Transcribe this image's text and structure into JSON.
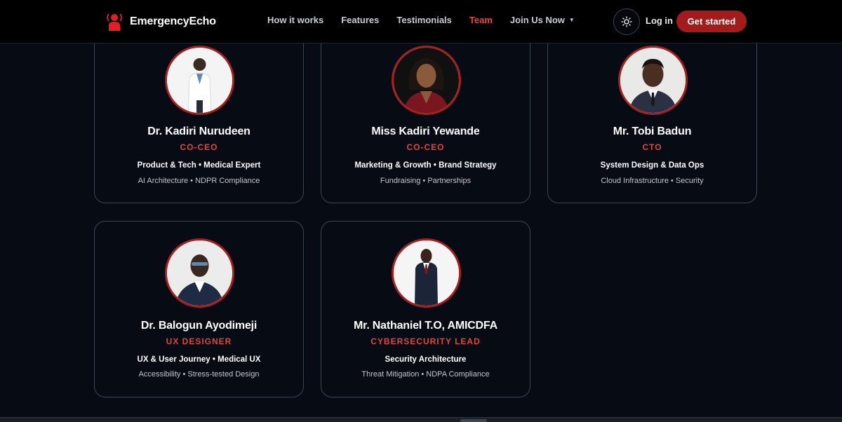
{
  "brand": {
    "name": "EmergencyEcho",
    "logo_icon": "alert-person-icon",
    "accent": "#e21f26"
  },
  "nav": {
    "items": [
      {
        "label": "How it works"
      },
      {
        "label": "Features"
      },
      {
        "label": "Testimonials"
      },
      {
        "label": "Team",
        "active": true
      },
      {
        "label": "Join Us Now",
        "dropdown": true
      }
    ]
  },
  "actions": {
    "theme_icon": "sun-icon",
    "login": "Log in",
    "get_started": "Get started"
  },
  "colors": {
    "background": "#070b14",
    "role": "#e0453f",
    "button": "#a31b1b",
    "avatar_ring": "#a8201e"
  },
  "team": [
    {
      "name": "Dr. Kadiri Nurudeen",
      "role": "CO-CEO",
      "skills": "Product & Tech • Medical Expert",
      "extras": "AI Architecture • NDPR Compliance"
    },
    {
      "name": "Miss Kadiri Yewande",
      "role": "CO-CEO",
      "skills": "Marketing & Growth • Brand Strategy",
      "extras": "Fundraising • Partnerships"
    },
    {
      "name": "Mr. Tobi Badun",
      "role": "CTO",
      "skills": "System Design & Data Ops",
      "extras": "Cloud Infrastructure • Security"
    },
    {
      "name": "Dr. Balogun Ayodimeji",
      "role": "UX DESIGNER",
      "skills": "UX & User Journey • Medical UX",
      "extras": "Accessibility • Stress-tested Design"
    },
    {
      "name": "Mr. Nathaniel T.O, AMICDFA",
      "role": "CYBERSECURITY LEAD",
      "skills": "Security Architecture",
      "extras": "Threat Mitigation • NDPA Compliance"
    }
  ]
}
